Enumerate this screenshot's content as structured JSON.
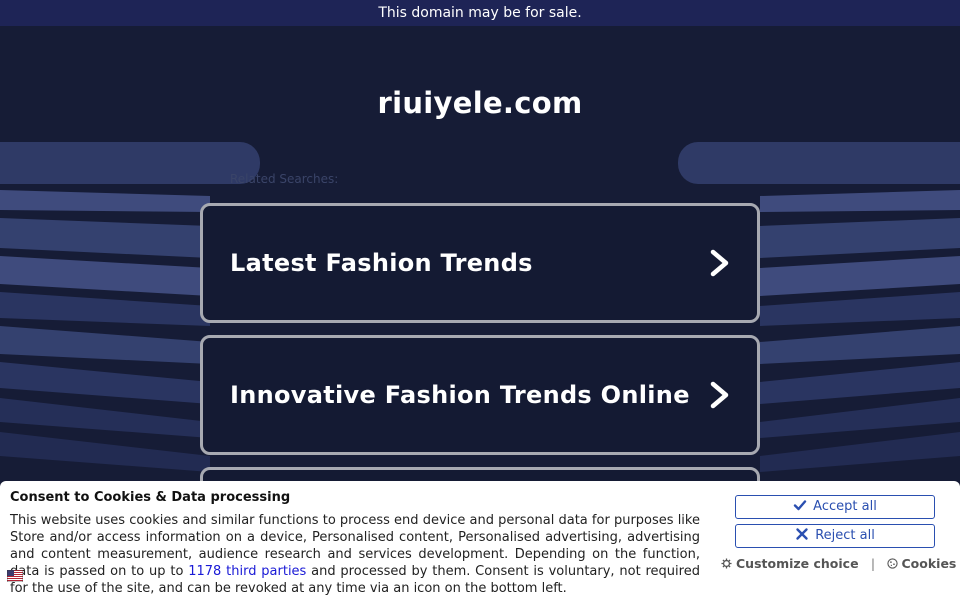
{
  "banner": {
    "text": "This domain may be for sale."
  },
  "hero": {
    "domain": "riuiyele.com",
    "related_label": "Related Searches:",
    "results": [
      {
        "label": "Latest Fashion Trends",
        "icon": "chevron-right-icon"
      },
      {
        "label": "Innovative Fashion Trends Online",
        "icon": "chevron-right-icon"
      }
    ]
  },
  "consent": {
    "title": "Consent to Cookies & Data processing",
    "text_before_link": "This website uses cookies and similar functions to process end device and personal data for purposes like Store and/or access information on a device, Personalised content, Personalised advertising, advertising and content measurement, audience research and services development. Depending on the function, data is passed on to up to ",
    "link_text": "1178 third parties",
    "text_after_link": " and processed by them. Consent is voluntary, not required for the use of the site, and can be revoked at any time via an icon on the bottom left.",
    "accept_label": "Accept all",
    "reject_label": "Reject all",
    "customize_label": "Customize choice",
    "separator": "|",
    "cookies_label": "Cookies"
  },
  "colors": {
    "banner_bg": "#1e2456",
    "page_bg": "#141a33",
    "card_border": "#a7a9b1",
    "button_accent": "#2a4fb0",
    "link": "#1a1ad6"
  }
}
